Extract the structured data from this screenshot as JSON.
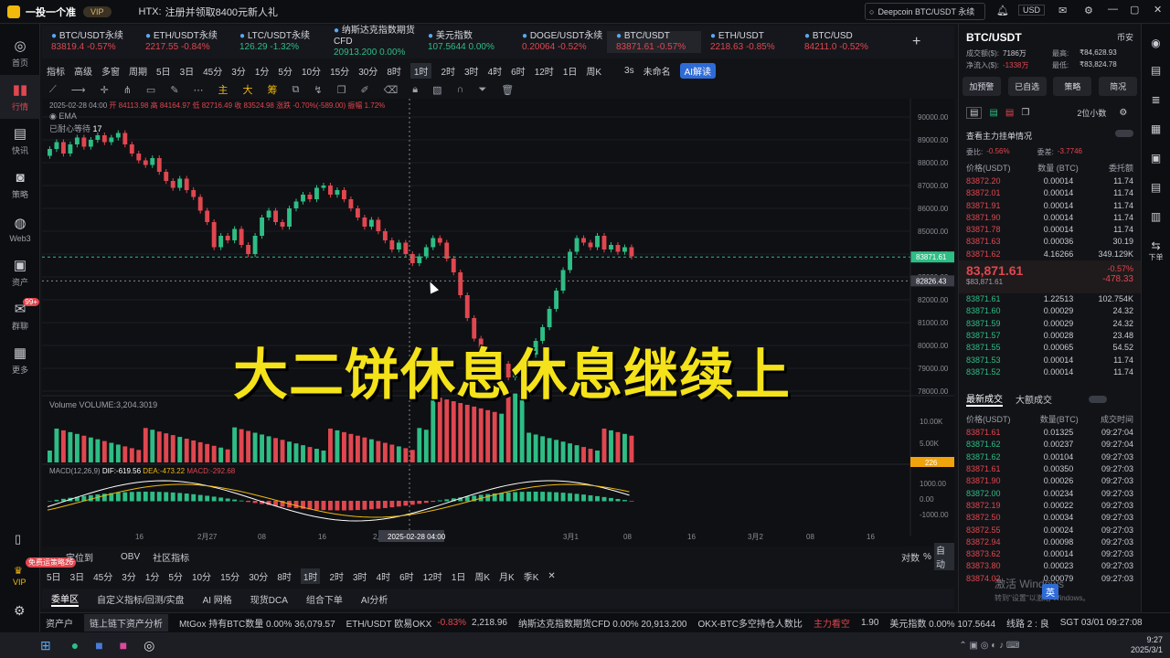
{
  "titlebar": {
    "app_name": "一投一个准",
    "vip_badge": "VIP",
    "notice_source": "HTX:",
    "notice_text": "注册并领取8400元新人礼",
    "search_placeholder": "Deepcoin BTC/USDT 永续",
    "currency": "USD"
  },
  "leftnav": {
    "items": [
      {
        "label": "首页",
        "icon": "home-icon"
      },
      {
        "label": "行情",
        "icon": "chart-icon"
      },
      {
        "label": "快讯",
        "icon": "news-icon"
      },
      {
        "label": "策略",
        "icon": "robot-icon"
      },
      {
        "label": "Web3",
        "icon": "web3-icon"
      },
      {
        "label": "资产",
        "icon": "wallet-icon"
      },
      {
        "label": "群聊",
        "icon": "chat-icon",
        "badge": "99+"
      },
      {
        "label": "更多",
        "icon": "grid-icon"
      }
    ],
    "promo": "免费运策略26",
    "vip_label": "VIP"
  },
  "tickers": [
    {
      "name": "BTC/USDT永续",
      "price": "83819.4",
      "change": "-0.57%",
      "dir": "red"
    },
    {
      "name": "ETH/USDT永续",
      "price": "2217.55",
      "change": "-0.84%",
      "dir": "red"
    },
    {
      "name": "LTC/USDT永续",
      "price": "126.29",
      "change": "-1.32%",
      "dir": "green"
    },
    {
      "name": "纳斯达克指数期货CFD",
      "price": "20913.200",
      "change": "0.00%",
      "dir": "green"
    },
    {
      "name": "美元指数",
      "price": "107.5644",
      "change": "0.00%",
      "dir": "green"
    },
    {
      "name": "DOGE/USDT永续",
      "price": "0.20064",
      "change": "-0.52%",
      "dir": "red"
    },
    {
      "name": "BTC/USDT",
      "price": "83871.61",
      "change": "-0.57%",
      "dir": "red"
    },
    {
      "name": "ETH/USDT",
      "price": "2218.63",
      "change": "-0.85%",
      "dir": "red"
    },
    {
      "name": "BTC/USD",
      "price": "84211.0",
      "change": "-0.52%",
      "dir": "red"
    }
  ],
  "toolbar": {
    "items": [
      "指标",
      "高级",
      "多窗",
      "周期",
      "5日",
      "3日",
      "45分",
      "3分",
      "1分",
      "5分",
      "10分",
      "15分",
      "30分",
      "8时",
      "1时",
      "2时",
      "3时",
      "4时",
      "6时",
      "12时",
      "1日",
      "周K",
      "3s",
      "未命名",
      "AI解读"
    ],
    "draw_tools": [
      "主",
      "大",
      "筹"
    ]
  },
  "chart_header": {
    "date": "2025-02-28 04:00",
    "open": "开 84113.98",
    "high": "高 84164.97",
    "low": "低 82716.49",
    "close": "收 83524.98",
    "change": "涨跌 -0.70%(-589.00)",
    "amp": "振幅 1.72%",
    "ema": "EMA",
    "bars": "已耐心等待",
    "bars_n": "17"
  },
  "price_axis": [
    "90000.00",
    "89000.00",
    "88000.00",
    "87000.00",
    "86000.00",
    "85000.00",
    "84000.00",
    "83000.00",
    "82000.00",
    "81000.00",
    "80000.00",
    "79000.00",
    "78000.00"
  ],
  "price_tags": {
    "last": "83871.61",
    "cross": "82826.43"
  },
  "volume": {
    "label": "Volume",
    "value": "VOLUME:3,204.3019",
    "axis": [
      "10.00K",
      "5.00K"
    ],
    "tag": "226"
  },
  "macd": {
    "label": "MACD(12,26,9)",
    "dif": "DIF:-619.56",
    "dea": "DEA:-473.22",
    "macd": "MACD:-292.68",
    "axis": [
      "1000.00",
      "0.00",
      "-1000.00"
    ]
  },
  "time_axis": [
    "16",
    "2月27",
    "08",
    "16",
    "2月",
    "2025-02-28 04:00",
    "3月1",
    "08",
    "16",
    "3月2",
    "08",
    "16"
  ],
  "bottom": {
    "labels": [
      "定位到",
      "OBV",
      "社区指标"
    ],
    "right": [
      "对数",
      "%",
      "自动"
    ],
    "timeframes": [
      "5日",
      "3日",
      "45分",
      "3分",
      "1分",
      "5分",
      "10分",
      "15分",
      "30分",
      "8时",
      "1时",
      "2时",
      "3时",
      "4时",
      "6时",
      "12时",
      "1日",
      "周K",
      "月K",
      "季K"
    ],
    "tabs": [
      "委单区",
      "自定义指标/回测/实盘",
      "AI 网格",
      "现货DCA",
      "组合下单",
      "AI分析"
    ]
  },
  "statusbar": {
    "items": [
      "资产户",
      "链上链下资产分析",
      "MtGox 持有BTC数量 0.00% 36,079.57",
      "ETH/USDT 欧易OKX",
      "-0.83%",
      "2,218.96",
      "纳斯达克指数期货CFD 0.00% 20,913.200",
      "OKX-BTC多空持仓人数比",
      "主力看空",
      "1.90",
      "美元指数 0.00% 107.5644",
      "线路 2 : 良",
      "SGT 03/01 09:27:08"
    ]
  },
  "caption": "大二饼休息休息继续上",
  "right": {
    "pair": "BTC/USDT",
    "exchange": "币安",
    "stats": [
      [
        "成交额($):",
        "7186万",
        "最高:",
        "₹84,628.93"
      ],
      [
        "净流入($):",
        "-1338万",
        "最低:",
        "₹83,824.78"
      ]
    ],
    "buttons": [
      "加预警",
      "已自选",
      "策略",
      "简况"
    ],
    "decimals": "2位小数",
    "depth_link": "查看主力挂单情况",
    "bias": [
      "委比:",
      "-0.56%",
      "委差:",
      "-3.7746"
    ],
    "book_headers": [
      "价格(USDT)",
      "数量 (BTC)",
      "委托额"
    ],
    "asks": [
      [
        "83872.20",
        "0.00014",
        "11.74"
      ],
      [
        "83872.01",
        "0.00014",
        "11.74"
      ],
      [
        "83871.91",
        "0.00014",
        "11.74"
      ],
      [
        "83871.90",
        "0.00014",
        "11.74"
      ],
      [
        "83871.78",
        "0.00014",
        "11.74"
      ],
      [
        "83871.63",
        "0.00036",
        "30.19"
      ],
      [
        "83871.62",
        "4.16266",
        "349.129K"
      ]
    ],
    "mid_price": "83,871.61",
    "mid_sub": "$83,871.61",
    "mid_change": "-0.57%",
    "mid_diff": "-478.33",
    "bids": [
      [
        "83871.61",
        "1.22513",
        "102.754K"
      ],
      [
        "83871.60",
        "0.00029",
        "24.32"
      ],
      [
        "83871.59",
        "0.00029",
        "24.32"
      ],
      [
        "83871.57",
        "0.00028",
        "23.48"
      ],
      [
        "83871.55",
        "0.00065",
        "54.52"
      ],
      [
        "83871.53",
        "0.00014",
        "11.74"
      ],
      [
        "83871.52",
        "0.00014",
        "11.74"
      ]
    ],
    "trades_tabs": [
      "最新成交",
      "大额成交"
    ],
    "trade_headers": [
      "价格(USDT)",
      "数量(BTC)",
      "成交时间"
    ],
    "trades": [
      [
        "83871.61",
        "0.01325",
        "09:27:04",
        "red"
      ],
      [
        "83871.62",
        "0.00237",
        "09:27:04",
        "green"
      ],
      [
        "83871.62",
        "0.00104",
        "09:27:03",
        "green"
      ],
      [
        "83871.61",
        "0.00350",
        "09:27:03",
        "red"
      ],
      [
        "83871.90",
        "0.00026",
        "09:27:03",
        "red"
      ],
      [
        "83872.00",
        "0.00234",
        "09:27:03",
        "green"
      ],
      [
        "83872.19",
        "0.00022",
        "09:27:03",
        "red"
      ],
      [
        "83872.50",
        "0.00034",
        "09:27:03",
        "red"
      ],
      [
        "83872.55",
        "0.00024",
        "09:27:03",
        "red"
      ],
      [
        "83872.94",
        "0.00098",
        "09:27:03",
        "red"
      ],
      [
        "83873.62",
        "0.00014",
        "09:27:03",
        "red"
      ],
      [
        "83873.80",
        "0.00023",
        "09:27:03",
        "red"
      ],
      [
        "83874.02",
        "0.00079",
        "09:27:03",
        "red"
      ]
    ]
  },
  "rightbar": [
    "币安",
    "下单"
  ],
  "taskbar": {
    "time": "9:27",
    "date": "2025/3/1",
    "watermark": "激活 Windows",
    "watermark2": "转到\"设置\"以激活 Windows。",
    "ime": "英"
  }
}
